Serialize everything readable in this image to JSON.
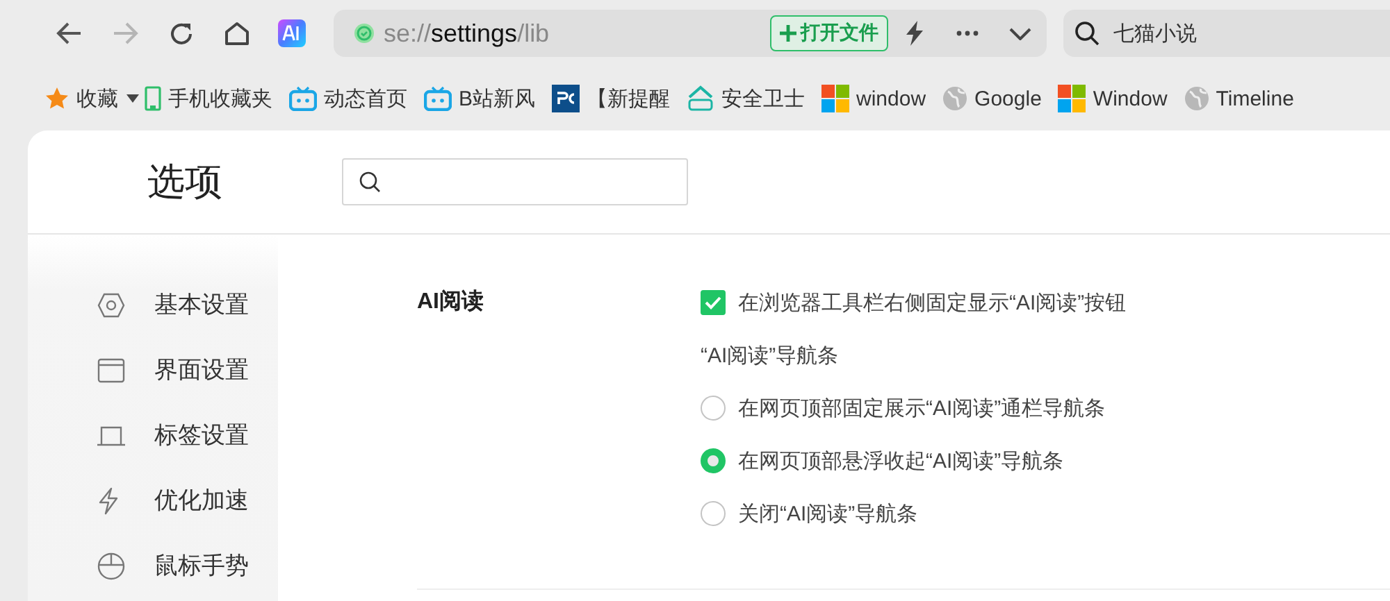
{
  "toolbar": {
    "url": {
      "scheme": "se://",
      "host": "settings",
      "path": "/lib"
    },
    "open_file_button": "打开文件",
    "search": {
      "value": "七猫小说"
    }
  },
  "bookmarks": [
    {
      "label": "收藏"
    },
    {
      "label": "手机收藏夹"
    },
    {
      "label": "动态首页"
    },
    {
      "label": "B站新风"
    },
    {
      "label": "【新提醒"
    },
    {
      "label": "安全卫士"
    },
    {
      "label": "window"
    },
    {
      "label": "Google"
    },
    {
      "label": "Window"
    },
    {
      "label": "Timeline"
    }
  ],
  "page": {
    "title": "选项"
  },
  "sidebar": {
    "items": [
      {
        "label": "基本设置"
      },
      {
        "label": "界面设置"
      },
      {
        "label": "标签设置"
      },
      {
        "label": "优化加速"
      },
      {
        "label": "鼠标手势"
      }
    ]
  },
  "section": {
    "title": "AI阅读",
    "options": [
      {
        "kind": "checkbox",
        "label": "在浏览器工具栏右侧固定显示“AI阅读”按钮",
        "checked": true
      },
      {
        "kind": "note",
        "label": "“AI阅读”导航条"
      },
      {
        "kind": "radio",
        "label": "在网页顶部固定展示“AI阅读”通栏导航条",
        "selected": false
      },
      {
        "kind": "radio",
        "label": "在网页顶部悬浮收起“AI阅读”导航条",
        "selected": true
      },
      {
        "kind": "radio",
        "label": "关闭“AI阅读”导航条",
        "selected": false
      }
    ]
  }
}
